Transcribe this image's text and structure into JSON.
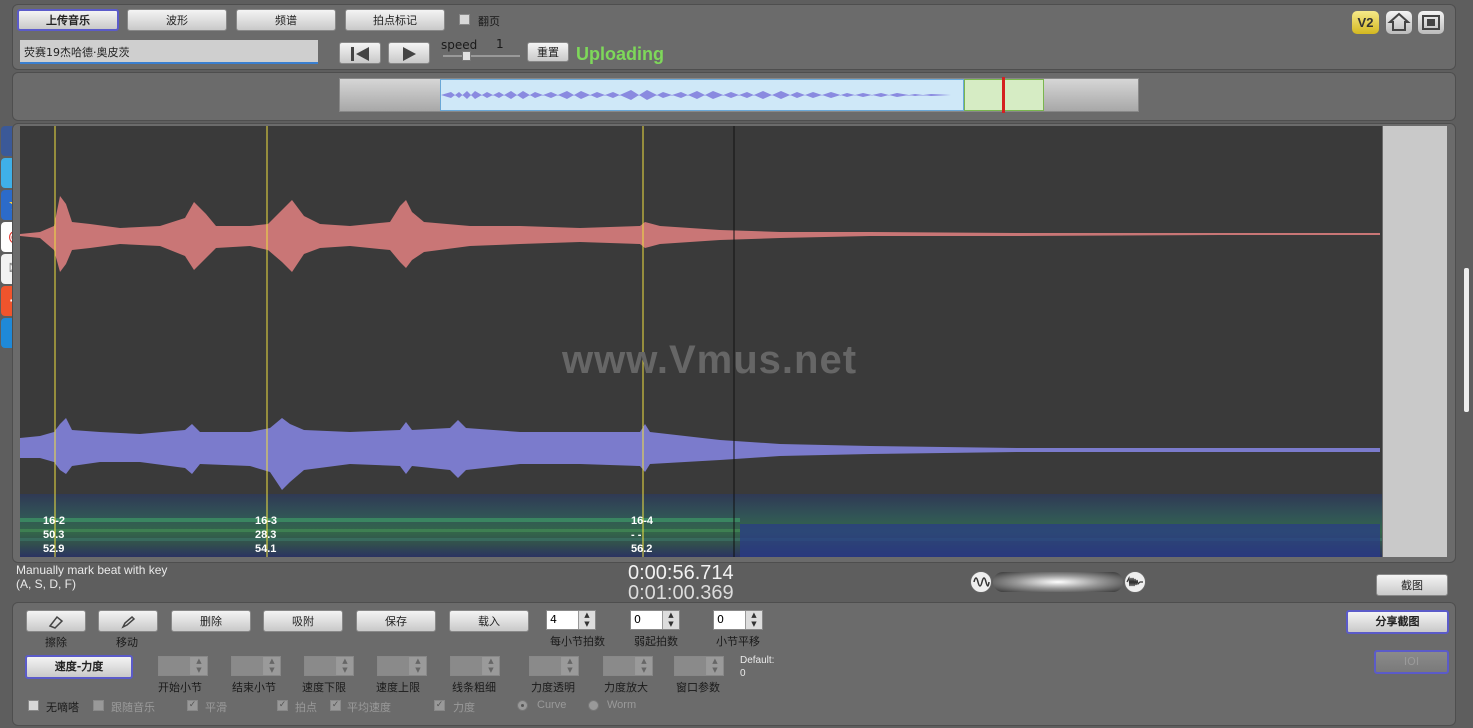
{
  "toolbar": {
    "upload_label": "上传音乐",
    "waveform_label": "波形",
    "spectrum_label": "频谱",
    "beat_mark_label": "拍点标记",
    "page_turn_label": "翻页",
    "file_name": "荧赛19杰哈德·奥皮茨",
    "speed_label": "speed",
    "speed_value": "1",
    "reset_label": "重置",
    "status_text": "Uploading",
    "v2_label": "V2"
  },
  "watermark": "www.Vmus.net",
  "markers": [
    {
      "label": "16-2",
      "v1": "50.3",
      "v2": "52.9"
    },
    {
      "label": "16-3",
      "v1": "28.3",
      "v2": "54.1"
    },
    {
      "label": "16-4",
      "v1": "- -",
      "v2": "56.2"
    }
  ],
  "hint": {
    "line1": "Manually mark beat with key",
    "line2": "(A, S, D, F)"
  },
  "time": {
    "current": "0:00:56.714",
    "total": "0:01:00.369"
  },
  "screenshot_label": "截图",
  "share_screenshot_label": "分享截图",
  "ioi_label": "IOI",
  "tools": {
    "erase_label": "擦除",
    "move_label": "移动",
    "delete_label": "删除",
    "snap_label": "吸附",
    "save_label": "保存",
    "load_label": "载入"
  },
  "beat_params": {
    "beats_per_bar_value": "4",
    "beats_per_bar_label": "每小节拍数",
    "pickup_value": "0",
    "pickup_label": "弱起拍数",
    "bar_offset_value": "0",
    "bar_offset_label": "小节平移"
  },
  "tempo_mode_label": "速度-力度",
  "tempo_params": [
    "开始小节",
    "结束小节",
    "速度下限",
    "速度上限",
    "线条粗细",
    "力度透明",
    "力度放大",
    "窗口参数"
  ],
  "default_label": "Default:",
  "default_value": "0",
  "options": {
    "no_sound": "无嘀嗒",
    "follow_music": "跟随音乐",
    "smooth": "平滑",
    "beat_point": "拍点",
    "average_speed": "平均速度",
    "dynamics": "力度",
    "curve": "Curve",
    "worm": "Worm"
  },
  "colors": {
    "waveform_top": "#c97676",
    "waveform_bottom": "#7b7bcc",
    "marker_line": "#f0e040",
    "status_green": "#7ed85a"
  }
}
